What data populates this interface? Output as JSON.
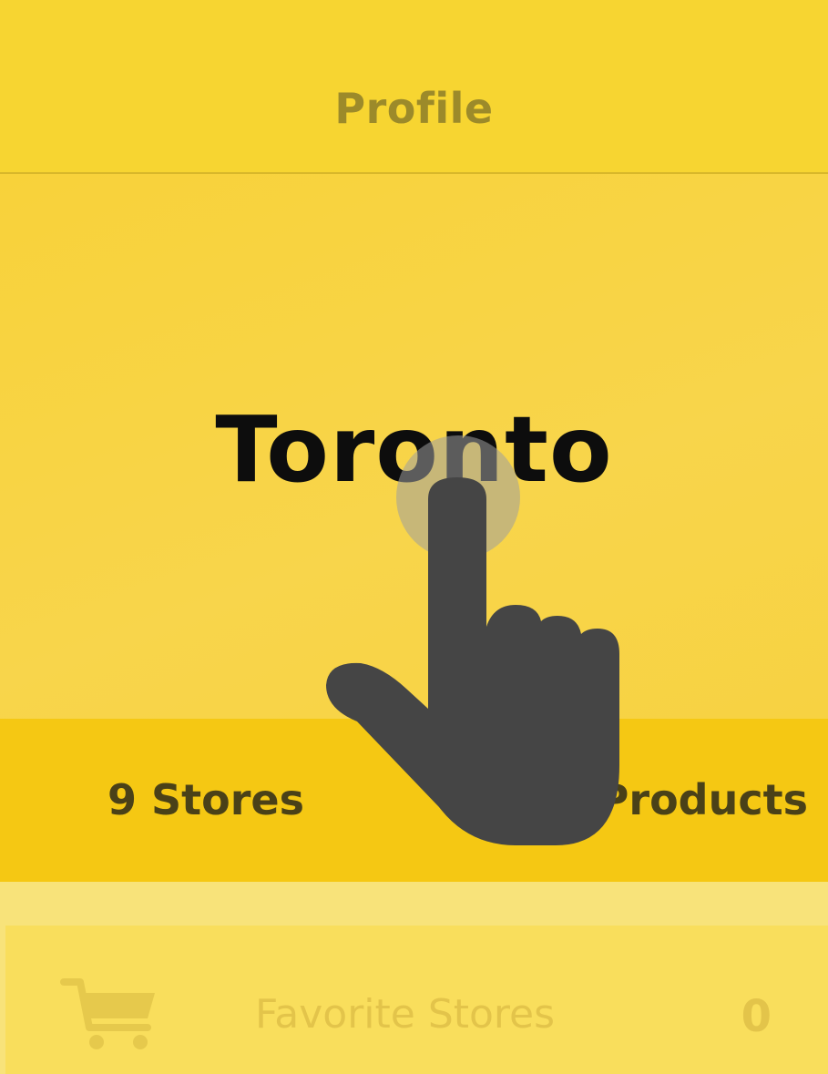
{
  "nav": {
    "title": "Profile"
  },
  "hero": {
    "city": "Toronto"
  },
  "stats": {
    "stores": "9 Stores",
    "products": "Products"
  },
  "list": {
    "favorite_stores_label": "Favorite Stores",
    "favorite_stores_count": "0",
    "icon": "cart-icon"
  },
  "overlay": {
    "gesture": "tap-hand-icon"
  },
  "colors": {
    "nav_bg": "#f7d531",
    "hero_bg": "#f8d54b",
    "stats_bg": "#f5c813",
    "hand": "#454545"
  }
}
